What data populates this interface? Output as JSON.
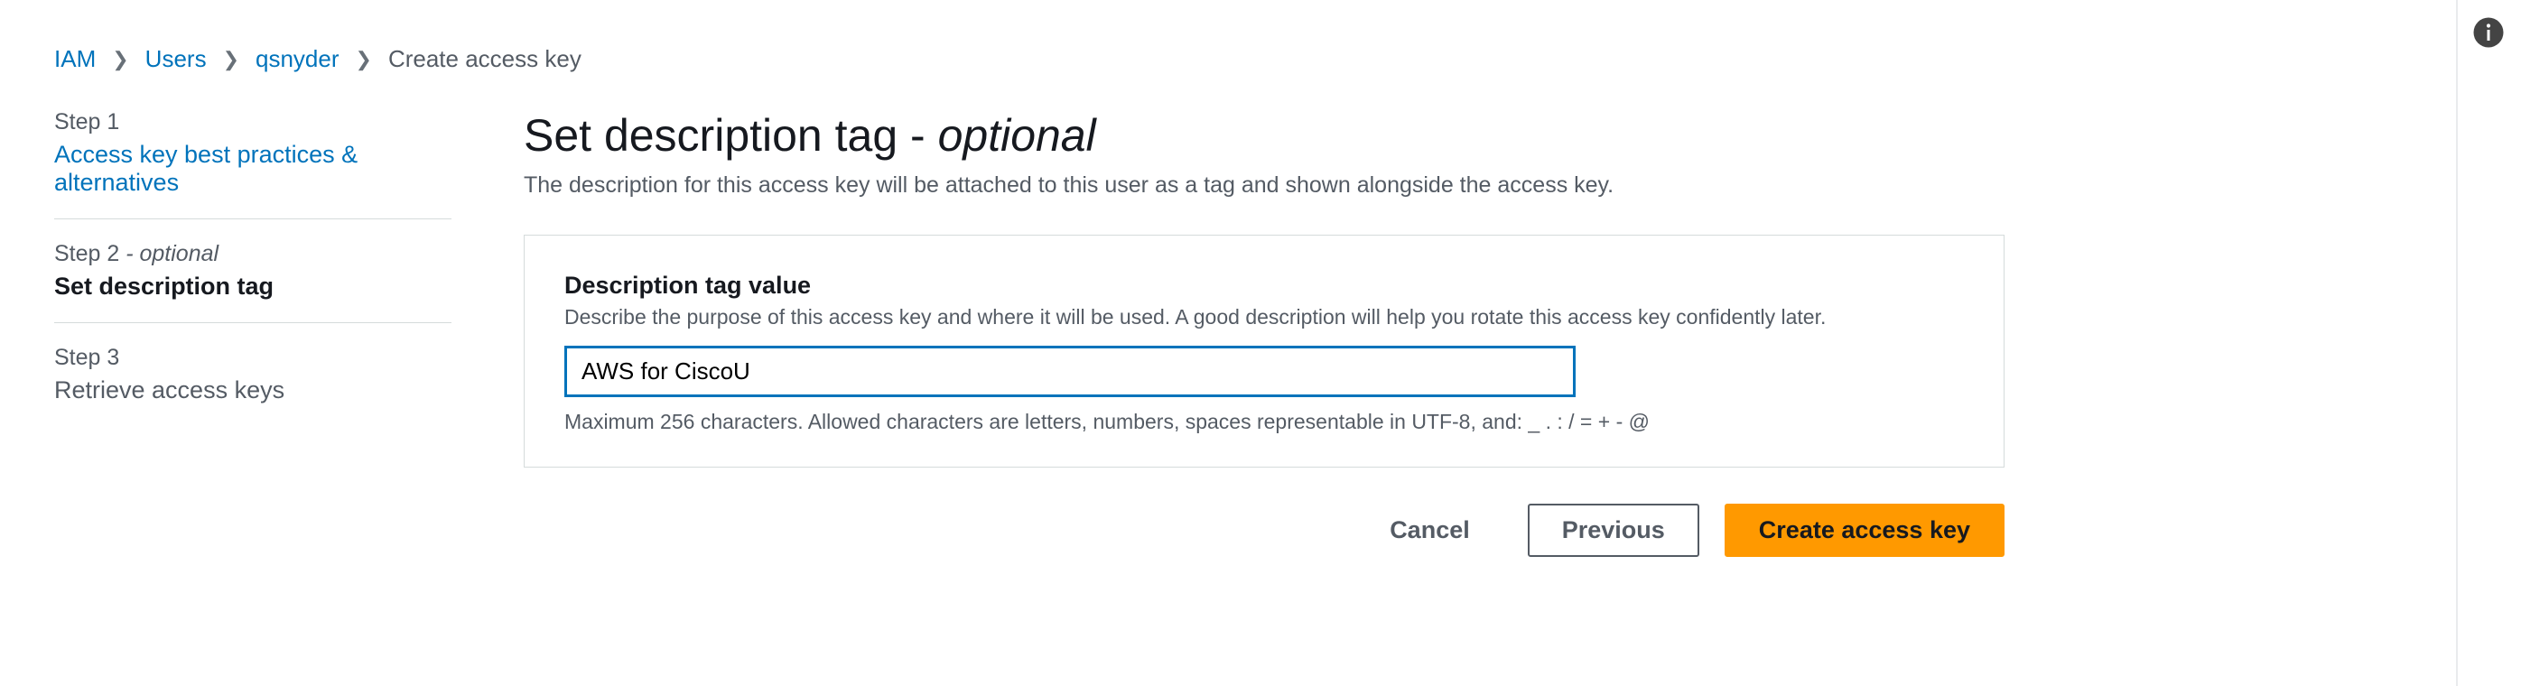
{
  "breadcrumb": {
    "items": [
      {
        "label": "IAM",
        "current": false
      },
      {
        "label": "Users",
        "current": false
      },
      {
        "label": "qsnyder",
        "current": false
      },
      {
        "label": "Create access key",
        "current": true
      }
    ]
  },
  "sidebar": {
    "steps": [
      {
        "label": "Step 1",
        "optional": false,
        "title": "Access key best practices & alternatives",
        "style": "link"
      },
      {
        "label": "Step 2",
        "optional": true,
        "title": "Set description tag",
        "style": "active"
      },
      {
        "label": "Step 3",
        "optional": false,
        "title": "Retrieve access keys",
        "style": "muted"
      }
    ],
    "optional_suffix": " - optional"
  },
  "page": {
    "title_main": "Set description tag",
    "title_sep": " - ",
    "title_optional": "optional",
    "subtitle": "The description for this access key will be attached to this user as a tag and shown alongside the access key."
  },
  "form": {
    "field_label": "Description tag value",
    "field_desc": "Describe the purpose of this access key and where it will be used. A good description will help you rotate this access key confidently later.",
    "field_value": "AWS for CiscoU",
    "field_hint": "Maximum 256 characters. Allowed characters are letters, numbers, spaces representable in UTF-8, and: _ . : / = + - @"
  },
  "actions": {
    "cancel": "Cancel",
    "previous": "Previous",
    "create": "Create access key"
  },
  "icons": {
    "info": "info-circle"
  }
}
